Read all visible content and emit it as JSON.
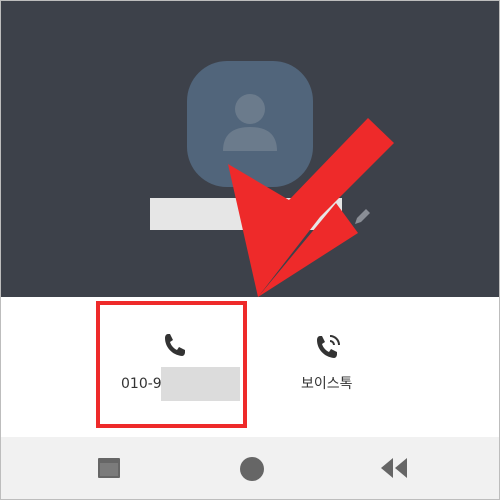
{
  "header": {
    "background": "#3d414a",
    "avatar_icon": "person-icon",
    "edit_icon": "pencil-icon"
  },
  "actions": {
    "call": {
      "label": "010-9",
      "icon": "phone-icon"
    },
    "voicetalk": {
      "label": "보이스톡",
      "icon": "voice-call-icon"
    }
  },
  "annotation": {
    "color": "#ee2a2a",
    "shape": "arrow-and-box"
  },
  "navbar": {
    "items": [
      {
        "icon": "recent-apps-icon"
      },
      {
        "icon": "home-icon"
      },
      {
        "icon": "back-icon"
      }
    ]
  }
}
